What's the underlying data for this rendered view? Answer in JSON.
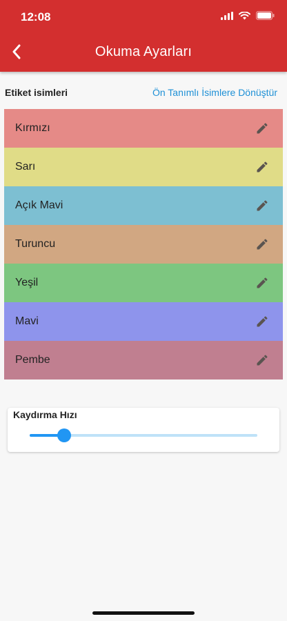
{
  "status_bar": {
    "time": "12:08"
  },
  "header": {
    "title": "Okuma Ayarları"
  },
  "labels_section": {
    "heading": "Etiket isimleri",
    "reset_link": "Ön Tanımlı İsimlere Dönüştür",
    "items": [
      {
        "label": "Kırmızı",
        "color": "#e58a87"
      },
      {
        "label": "Sarı",
        "color": "#e0dc87"
      },
      {
        "label": "Açık Mavi",
        "color": "#7dbfd2"
      },
      {
        "label": "Turuncu",
        "color": "#d1a782"
      },
      {
        "label": "Yeşil",
        "color": "#7dc680"
      },
      {
        "label": "Mavi",
        "color": "#8e94ec"
      },
      {
        "label": "Pembe",
        "color": "#c07f90"
      }
    ]
  },
  "scroll_speed": {
    "title": "Kaydırma Hızı",
    "value_fraction": 0.15
  },
  "colors": {
    "accent": "#d32f2f",
    "link": "#1e90d6",
    "slider": "#2196f3"
  }
}
